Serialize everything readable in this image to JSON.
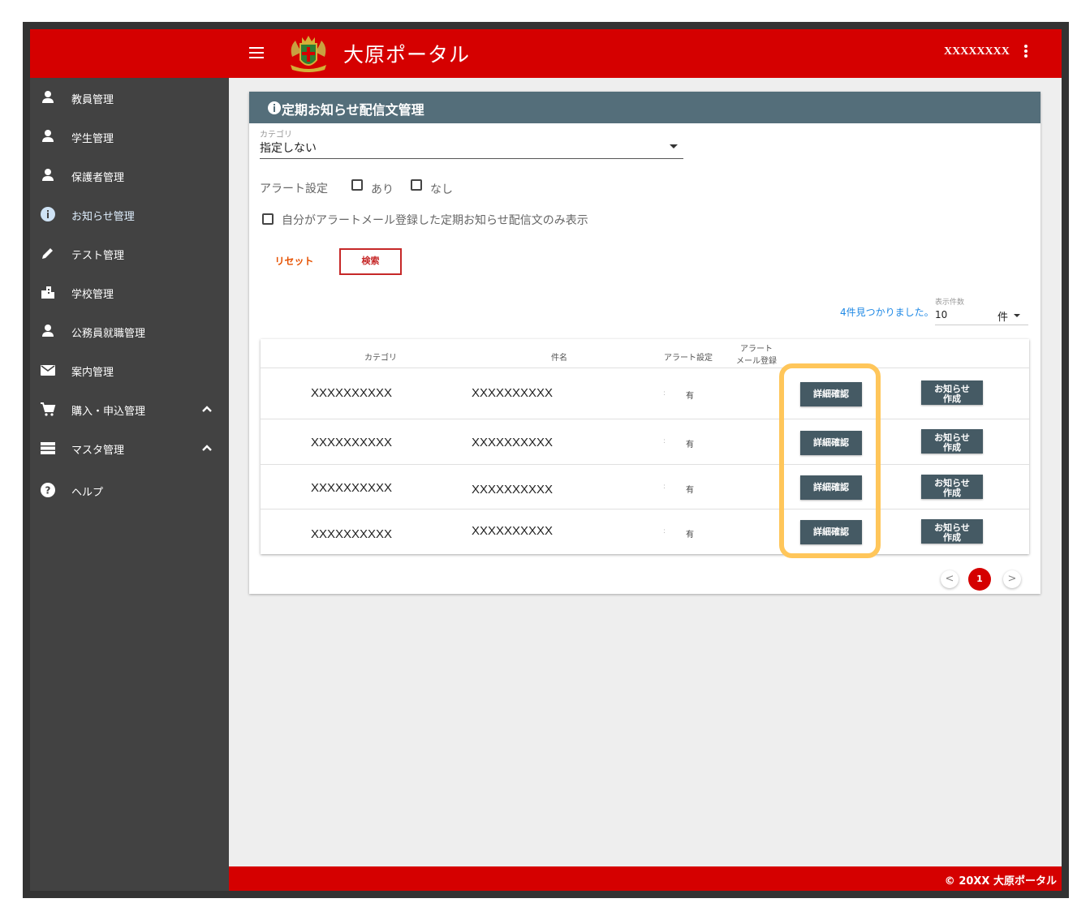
{
  "header": {
    "title": "大原ポータル",
    "user": "XXXXXXXX"
  },
  "sidebar": {
    "items": [
      {
        "label": "教員管理",
        "icon": "person-icon"
      },
      {
        "label": "学生管理",
        "icon": "person-icon"
      },
      {
        "label": "保護者管理",
        "icon": "person-icon"
      },
      {
        "label": "お知らせ管理",
        "icon": "info-icon"
      },
      {
        "label": "テスト管理",
        "icon": "pencil-icon"
      },
      {
        "label": "学校管理",
        "icon": "building-icon"
      },
      {
        "label": "公務員就職管理",
        "icon": "person-icon"
      },
      {
        "label": "案内管理",
        "icon": "mail-icon"
      },
      {
        "label": "購入・申込管理",
        "icon": "cart-icon"
      },
      {
        "label": "マスタ管理",
        "icon": "list-icon"
      },
      {
        "label": "ヘルプ",
        "icon": "help-icon"
      }
    ]
  },
  "card": {
    "title": "定期お知らせ配信文管理"
  },
  "filters": {
    "category_label": "カテゴリ",
    "category_value": "指定しない",
    "alert_label": "アラート設定",
    "alert_yes": "あり",
    "alert_no": "なし",
    "only_mine": "自分がアラートメール登録した定期お知らせ配信文のみ表示",
    "reset": "リセット",
    "search": "検索"
  },
  "results": {
    "found": "4件見つかりました。",
    "per_page_label": "表示件数",
    "per_page_value": "10",
    "per_page_unit": "件"
  },
  "table": {
    "headers": {
      "category": "カテゴリ",
      "subject": "件名",
      "alert": "アラート設定",
      "alert_mail_1": "アラート",
      "alert_mail_2": "メール登録"
    },
    "rows": [
      {
        "category": "XXXXXXXXXX",
        "subject": "XXXXXXXXXX",
        "alert": "有"
      },
      {
        "category": "XXXXXXXXXX",
        "subject": "XXXXXXXXXX",
        "alert": "有"
      },
      {
        "category": "XXXXXXXXXX",
        "subject": "XXXXXXXXXX",
        "alert": "有"
      },
      {
        "category": "XXXXXXXXXX",
        "subject": "XXXXXXXXXX",
        "alert": "有"
      }
    ],
    "detail_button": "詳細確認",
    "make_button_1": "お知らせ",
    "make_button_2": "作成"
  },
  "pagination": {
    "prev": "<",
    "current": "1",
    "next": ">"
  },
  "footer": {
    "text": "© 20XX 大原ポータル"
  },
  "colors": {
    "brand_red": "#d50000",
    "sidebar": "#424242",
    "card_header": "#546e7a",
    "button": "#455a64",
    "highlight": "#ffc65a"
  }
}
